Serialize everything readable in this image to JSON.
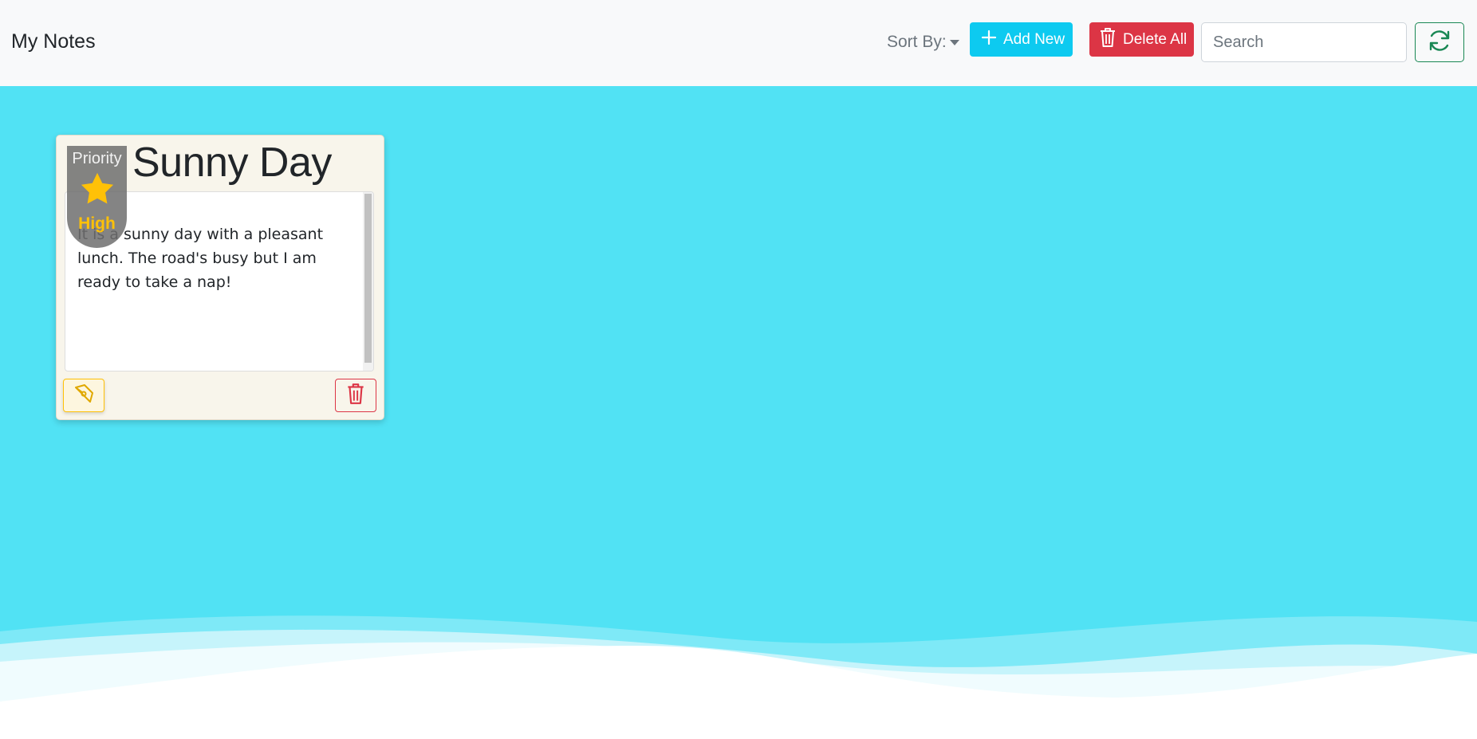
{
  "navbar": {
    "brand": "My Notes",
    "sort_label": "Sort By:",
    "add_label": "Add New",
    "delete_all_label": "Delete All",
    "search_placeholder": "Search",
    "search_value": ""
  },
  "notes": [
    {
      "title": "Sunny Day",
      "body": "It is a sunny day with a pleasant lunch. The road's busy but I am ready to take a nap!",
      "priority_label": "Priority",
      "priority_level": "High"
    }
  ],
  "icons": {
    "add": "plus-icon",
    "delete_all": "trash-icon",
    "refresh": "refresh-icon",
    "priority": "star-icon",
    "edit": "pen-icon",
    "delete": "trash-icon"
  },
  "colors": {
    "background": "#51e2f4",
    "add_button": "#0dcaf0",
    "delete_button": "#dc3545",
    "refresh_border": "#198754",
    "priority_high": "#ffc107",
    "card_background": "#f8f5eb"
  }
}
